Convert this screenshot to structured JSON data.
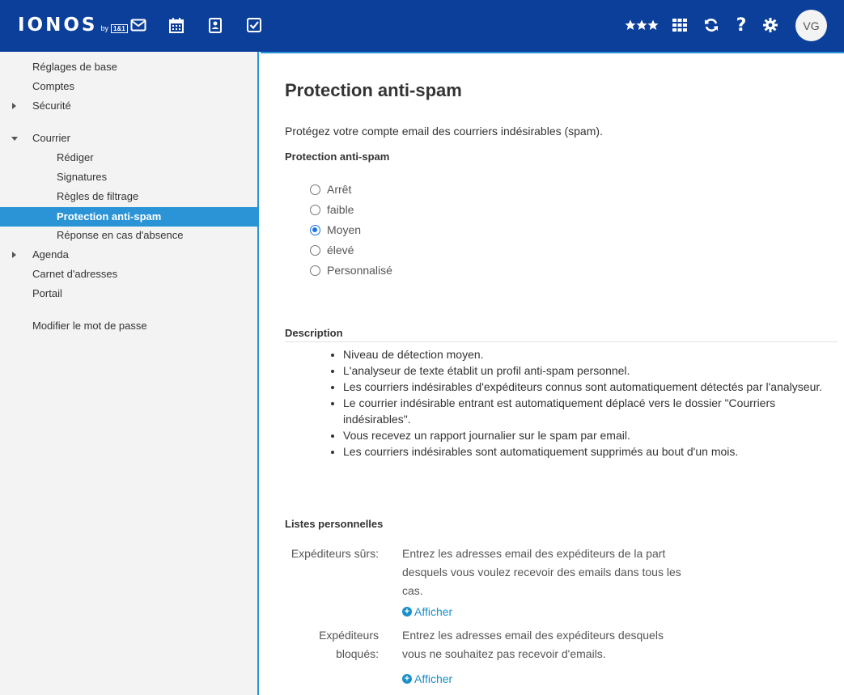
{
  "header": {
    "logo": {
      "main": "IONOS",
      "by": "by",
      "brand": "1&1"
    },
    "icons": [
      "mail-icon",
      "calendar-icon",
      "contacts-icon",
      "tasks-icon",
      "stars-icon",
      "apps-grid-icon",
      "refresh-icon",
      "help-icon",
      "gear-icon"
    ],
    "avatar_initials": "VG"
  },
  "sidebar": {
    "items": [
      {
        "label": "Réglages de base"
      },
      {
        "label": "Comptes"
      },
      {
        "label": "Sécurité"
      },
      {
        "label": "Courrier"
      },
      {
        "label": "Rédiger"
      },
      {
        "label": "Signatures"
      },
      {
        "label": "Règles de filtrage"
      },
      {
        "label": "Protection anti-spam"
      },
      {
        "label": "Réponse en cas d'absence"
      },
      {
        "label": "Agenda"
      },
      {
        "label": "Carnet d'adresses"
      },
      {
        "label": "Portail"
      },
      {
        "label": "Modifier le mot de passe"
      }
    ]
  },
  "main": {
    "title": "Protection anti-spam",
    "intro": "Protégez votre compte email des courriers indésirables (spam).",
    "spam_section_title": "Protection anti-spam",
    "options": [
      {
        "label": "Arrêt",
        "checked": false
      },
      {
        "label": "faible",
        "checked": false
      },
      {
        "label": "Moyen",
        "checked": true
      },
      {
        "label": "élevé",
        "checked": false
      },
      {
        "label": "Personnalisé",
        "checked": false
      }
    ],
    "description_title": "Description",
    "description_items": [
      "Niveau de détection moyen.",
      "L'analyseur de texte établit un profil anti-spam personnel.",
      "Les courriers indésirables d'expéditeurs connus sont automatiquement détectés par l'analyseur.",
      "Le courrier indésirable entrant est automatiquement déplacé vers le dossier \"Courriers indésirables\".",
      "Vous recevez un rapport journalier sur le spam par email.",
      "Les courriers indésirables sont automatiquement supprimés au bout d'un mois."
    ],
    "lists_title": "Listes personnelles",
    "safe_senders": {
      "label": "Expéditeurs sûrs:",
      "text": "Entrez les adresses email des expéditeurs de la part desquels vous voulez recevoir des emails dans tous les cas.",
      "link": "Afficher"
    },
    "blocked_senders": {
      "label": "Expéditeurs bloqués:",
      "text": "Entrez les adresses email des expéditeurs desquels vous ne souhaitez pas recevoir d'emails.",
      "link": "Afficher"
    }
  },
  "colors": {
    "header_bg": "#0b3f9a",
    "accent": "#2a94d6",
    "link": "#1a8fc9",
    "sidebar_bg": "#f3f3f3"
  }
}
